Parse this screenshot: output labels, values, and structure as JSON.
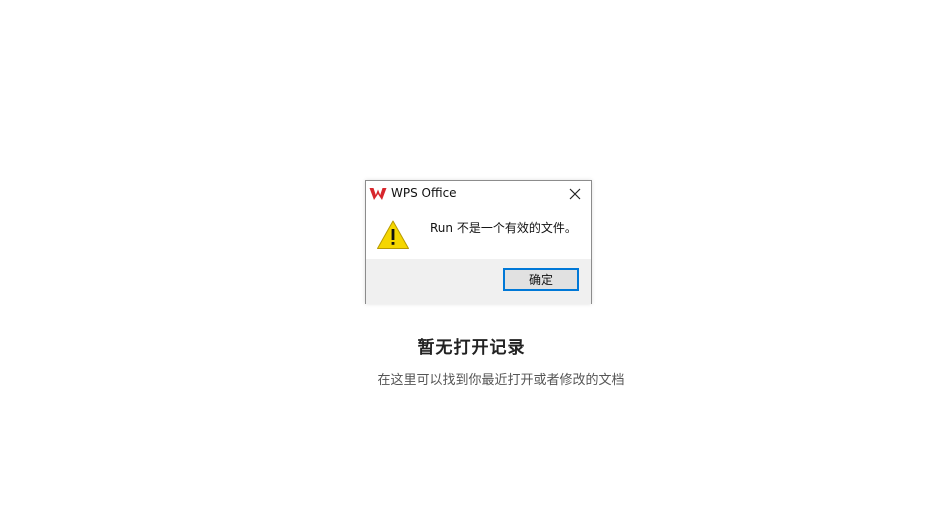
{
  "empty_state": {
    "title": "暂无打开记录",
    "subtitle": "在这里可以找到你最近打开或者修改的文档"
  },
  "dialog": {
    "title": "WPS Office",
    "message": "Run 不是一个有效的文件。",
    "ok_label": "确定",
    "icons": {
      "app": "wps-logo-icon",
      "close": "close-icon",
      "warning": "warning-icon"
    },
    "colors": {
      "logo_red": "#d7262c",
      "warning_yellow": "#f5d600",
      "button_focus_border": "#0078d7",
      "footer_bg": "#f0f0f0"
    }
  }
}
